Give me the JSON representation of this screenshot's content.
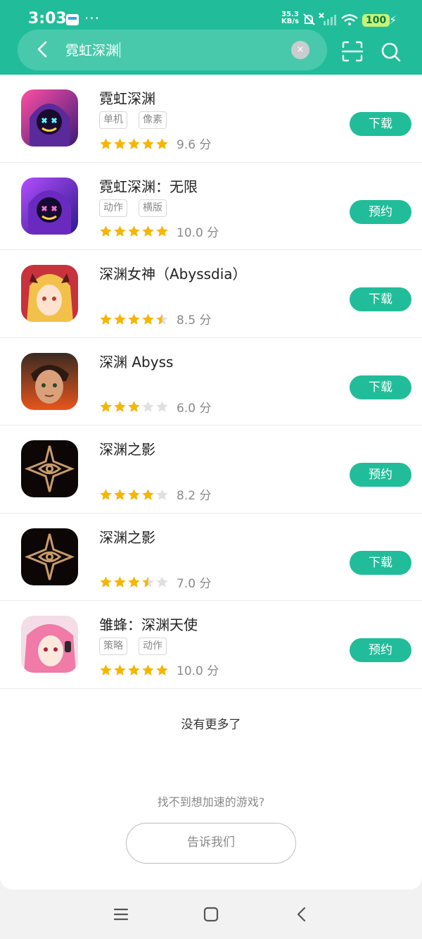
{
  "status_bar": {
    "time": "3:03",
    "more": "···",
    "speed_value": "35.3",
    "speed_unit": "KB/s",
    "battery": "100"
  },
  "search": {
    "query": "霓虹深渊",
    "clear_symbol": "×"
  },
  "games": [
    {
      "title": "霓虹深渊",
      "tags": [
        "单机",
        "像素"
      ],
      "rating": 5,
      "score": "9.6 分",
      "action": "下载",
      "icon": "neon-abyss-icon"
    },
    {
      "title": "霓虹深渊：无限",
      "tags": [
        "动作",
        "横版"
      ],
      "rating": 5,
      "score": "10.0 分",
      "action": "预约",
      "icon": "neon-abyss-infinite-icon"
    },
    {
      "title": "深渊女神（Abyssdia）",
      "tags": [],
      "rating": 4.5,
      "score": "8.5 分",
      "action": "下载",
      "icon": "abyssdia-icon"
    },
    {
      "title": "深渊 Abyss",
      "tags": [],
      "rating": 3,
      "score": "6.0 分",
      "action": "下载",
      "icon": "abyss-icon"
    },
    {
      "title": "深渊之影",
      "tags": [],
      "rating": 4,
      "score": "8.2 分",
      "action": "预约",
      "icon": "abyss-shadow-icon"
    },
    {
      "title": "深渊之影",
      "tags": [],
      "rating": 3.5,
      "score": "7.0 分",
      "action": "下载",
      "icon": "abyss-shadow-icon"
    },
    {
      "title": "雏蜂：深渊天使",
      "tags": [
        "策略",
        "动作"
      ],
      "rating": 5,
      "score": "10.0 分",
      "action": "预约",
      "icon": "brynhildr-icon"
    }
  ],
  "footer": {
    "no_more": "没有更多了",
    "not_found": "找不到想加速的游戏?",
    "tell_us": "告诉我们"
  },
  "colors": {
    "accent": "#21bd9a",
    "star": "#f7b500",
    "star_empty": "#e0e0e0"
  }
}
